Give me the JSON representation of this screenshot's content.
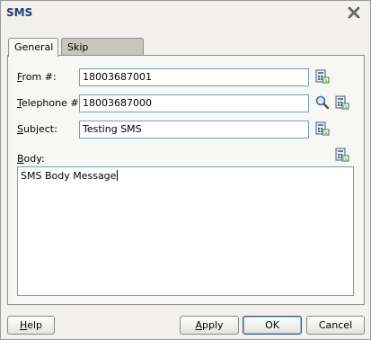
{
  "window": {
    "title": "SMS"
  },
  "tabs": [
    {
      "label": "General",
      "active": true
    },
    {
      "label": "Skip Condition",
      "active": false
    }
  ],
  "form": {
    "from": {
      "label_mnemonic": "F",
      "label_rest": "rom #:",
      "value": "18003687001"
    },
    "telephone": {
      "label_mnemonic": "T",
      "label_rest": "elephone #:",
      "value": "18003687000"
    },
    "subject": {
      "label_mnemonic": "S",
      "label_rest": "ubject:",
      "value": "Testing SMS"
    },
    "body": {
      "label_mnemonic": "B",
      "label_rest": "ody:",
      "value": "SMS Body Message"
    }
  },
  "buttons": {
    "help": {
      "mnemonic": "H",
      "rest": "elp"
    },
    "apply": {
      "mnemonic": "A",
      "rest": "pply"
    },
    "ok": "OK",
    "cancel": "Cancel"
  },
  "icons": {
    "close": "close-icon",
    "expression_builder": "expression-builder-icon",
    "search": "search-icon"
  },
  "colors": {
    "title_text": "#1f3b6d",
    "tab_inactive_bg": "#c7c6bd",
    "field_border": "#7f9db9"
  }
}
